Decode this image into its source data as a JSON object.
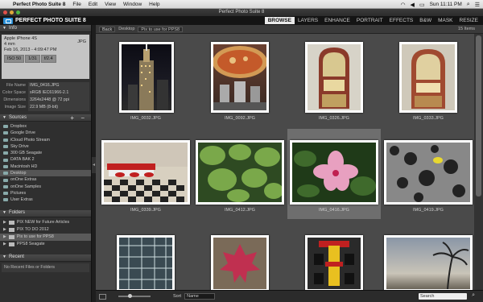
{
  "menubar": {
    "apple": "",
    "items": [
      "Perfect Photo Suite 8",
      "File",
      "Edit",
      "View",
      "Window",
      "Help"
    ],
    "clock": "Sun 11:11 PM"
  },
  "window": {
    "title": "Perfect Photo Suite 8"
  },
  "app": {
    "logo": "PERFECT PHOTO SUITE 8",
    "modules": [
      "BROWSE",
      "LAYERS",
      "ENHANCE",
      "PORTRAIT",
      "EFFECTS",
      "B&W",
      "MASK",
      "RESIZE"
    ],
    "active_module": "BROWSE"
  },
  "info": {
    "header": "Info",
    "device": "Apple iPhone 4S",
    "ext": "JPG",
    "lens": "4 mm",
    "date": "Feb 16, 2013 - 4:09:47 PM",
    "iso": "ISO 50",
    "shutter": "1/31",
    "aperture": "f/2.4",
    "rows": [
      {
        "k": "File Name",
        "v": "IMG_0416.JPG"
      },
      {
        "k": "Color Space",
        "v": "sRGB IEC61966-2.1"
      },
      {
        "k": "Dimensions",
        "v": "3264x2448 @ 72 ppi"
      },
      {
        "k": "Image Size",
        "v": "22.9 MB (8-bit)"
      }
    ]
  },
  "sources": {
    "header": "Sources",
    "controls": "+ −",
    "items": [
      "Dropbox",
      "Google Drive",
      "iCloud Photo Stream",
      "Sky Drive",
      "300 GB Seagate",
      "DATA BAK 2",
      "Macintosh HD",
      "Desktop",
      "onOne Extras",
      "onOne Samples",
      "Pictures",
      "User Extras"
    ],
    "selected": 7
  },
  "folders": {
    "header": "Folders",
    "items": [
      "PIX NEW for Future Articles",
      "PIX TO DO 2012",
      "Pix to use for PPS8",
      "PPS8 Seagate"
    ],
    "selected": 2
  },
  "recent": {
    "header": "Recent",
    "empty": "No Recent Files or Folders"
  },
  "browser": {
    "back": "Back",
    "crumbs": [
      "Desktop",
      "Pix to use for PPS8"
    ],
    "count": "15 Items",
    "thumbnails": [
      "IMG_0032.JPG",
      "IMG_0092.JPG",
      "IMG_0326.JPG",
      "IMG_0333.JPG",
      "IMG_0339.JPG",
      "IMG_0412.JPG",
      "IMG_0416.JPG",
      "IMG_0419.JPG",
      "",
      "",
      "",
      ""
    ],
    "selected_index": 6,
    "sort_label": "Sort",
    "sort_value": "Name",
    "search_placeholder": "Search"
  },
  "colors": {
    "accent": "#2a8fd6",
    "panel": "#2f2f2f",
    "grid_bg": "#4a4a4a",
    "selected_cell": "#6e6e6e"
  }
}
